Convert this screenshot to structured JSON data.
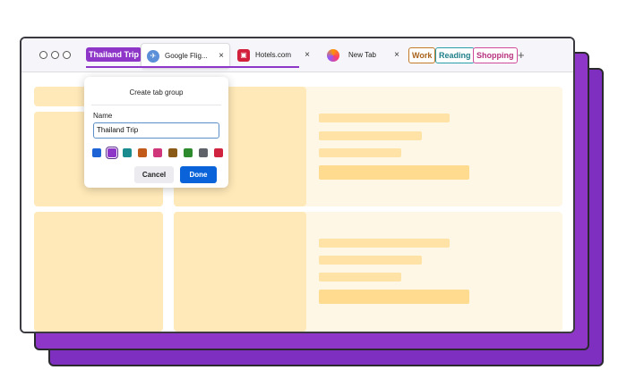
{
  "tab_groups": {
    "thailand": "Thailand Trip",
    "work": "Work",
    "reading": "Reading",
    "shopping": "Shopping"
  },
  "tabs": [
    {
      "label": "Google Flig...",
      "icon": "airplane-icon",
      "close": "×"
    },
    {
      "label": "Hotels.com",
      "icon": "hotels-icon",
      "close": "×"
    },
    {
      "label": "New Tab",
      "icon": "firefox-icon",
      "close": "×"
    }
  ],
  "new_tab_button": "+",
  "dialog": {
    "title": "Create tab group",
    "name_label": "Name",
    "name_value": "Thailand Trip",
    "swatches": [
      "#1e63d6",
      "#8e36c8",
      "#1a8c8f",
      "#c25a1a",
      "#d0367a",
      "#8a5a16",
      "#2d8a2d",
      "#5f6268",
      "#d0233f"
    ],
    "selected_swatch": "#8e36c8",
    "cancel_label": "Cancel",
    "done_label": "Done"
  },
  "colors": {
    "accent_purple": "#8e36c8",
    "done_blue": "#0b63d9",
    "placeholder_yellow": "#ffe9b8"
  }
}
